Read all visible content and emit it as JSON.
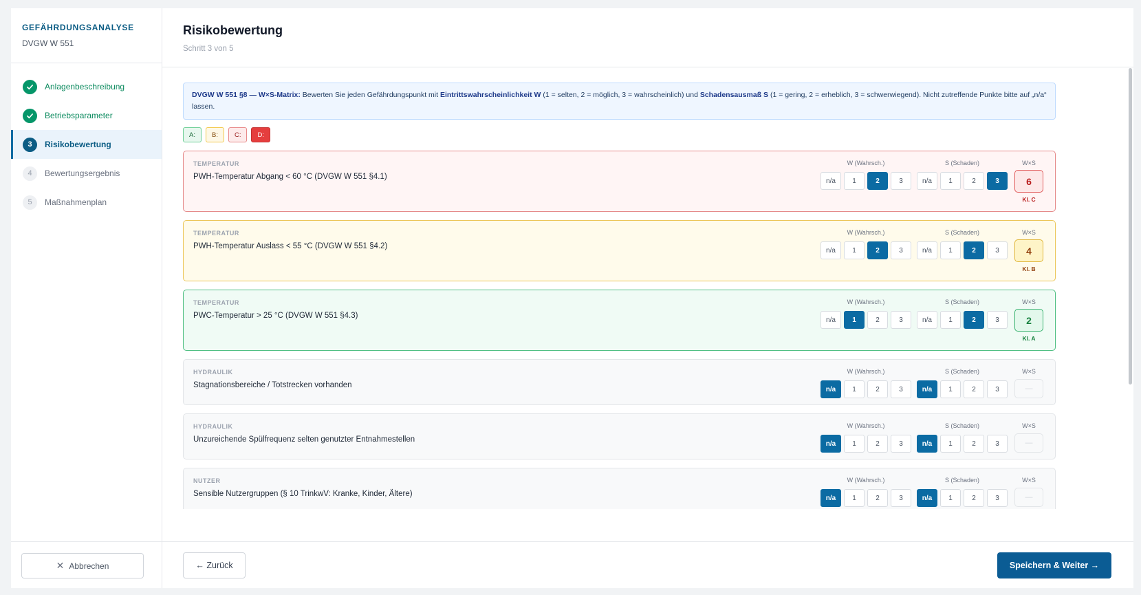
{
  "sidebar": {
    "title": "GEFÄHRDUNGSANALYSE",
    "subtitle": "DVGW W 551",
    "steps": [
      {
        "number": "1",
        "label": "Anlagenbeschreibung",
        "state": "done",
        "icon": "check-icon"
      },
      {
        "number": "2",
        "label": "Betriebsparameter",
        "state": "done",
        "icon": "check-icon"
      },
      {
        "number": "3",
        "label": "Risikobewertung",
        "state": "active"
      },
      {
        "number": "4",
        "label": "Bewertungsergebnis",
        "state": "todo"
      },
      {
        "number": "5",
        "label": "Maßnahmenplan",
        "state": "todo"
      }
    ],
    "cancel_label": "Abbrechen",
    "cancel_icon": "close-icon"
  },
  "header": {
    "title": "Risikobewertung",
    "subtitle": "Schritt 3 von 5"
  },
  "info": {
    "bold1": "DVGW W 551 §8 — W×S-Matrix:",
    "t1": " Bewerten Sie jeden Gefährdungspunkt mit ",
    "bold2": "Eintrittswahrscheinlichkeit W",
    "t2": " (1 = selten, 2 = möglich, 3 = wahrscheinlich) und ",
    "bold3": "Schadensausmaß S",
    "t3": " (1 = gering, 2 = erheblich, 3 = schwerwiegend). Nicht zutreffende Punkte bitte auf „n/a“ lassen."
  },
  "legend": [
    "A:",
    "B:",
    "C:",
    "D:"
  ],
  "labels": {
    "w_group": "W (Wahrsch.)",
    "s_group": "S (Schaden)",
    "result": "W×S",
    "options": [
      "n/a",
      "1",
      "2",
      "3"
    ]
  },
  "rows": [
    {
      "category": "TEMPERATUR",
      "text": "PWH-Temperatur Abgang < 60 °C (DVGW W 551 §4.1)",
      "w": "2",
      "s": "3",
      "result": "6",
      "klasse": "Kl. C",
      "level": "c"
    },
    {
      "category": "TEMPERATUR",
      "text": "PWH-Temperatur Auslass < 55 °C (DVGW W 551 §4.2)",
      "w": "2",
      "s": "2",
      "result": "4",
      "klasse": "Kl. B",
      "level": "b"
    },
    {
      "category": "TEMPERATUR",
      "text": "PWC-Temperatur > 25 °C (DVGW W 551 §4.3)",
      "w": "1",
      "s": "2",
      "result": "2",
      "klasse": "Kl. A",
      "level": "a"
    },
    {
      "category": "HYDRAULIK",
      "text": "Stagnationsbereiche / Totstrecken vorhanden",
      "w": "n/a",
      "s": "n/a",
      "result": "—",
      "klasse": "",
      "level": "n"
    },
    {
      "category": "HYDRAULIK",
      "text": "Unzureichende Spülfrequenz selten genutzter Entnahmestellen",
      "w": "n/a",
      "s": "n/a",
      "result": "—",
      "klasse": "",
      "level": "n"
    },
    {
      "category": "NUTZER",
      "text": "Sensible Nutzergruppen (§ 10 TrinkwV: Kranke, Kinder, Ältere)",
      "w": "n/a",
      "s": "n/a",
      "result": "—",
      "klasse": "",
      "level": "n"
    }
  ],
  "footer": {
    "back_label": "← Zurück",
    "save_label": "Speichern & Weiter →"
  },
  "colors": {
    "primary": "#0b5c94",
    "done": "#059669",
    "class_a": "#15803d",
    "class_b": "#92400e",
    "class_c": "#b91c1c",
    "class_d": "#e53e3e"
  }
}
